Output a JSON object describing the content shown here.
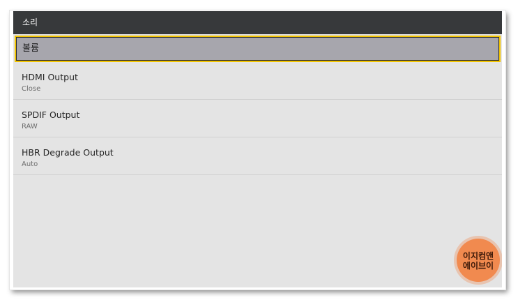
{
  "header": {
    "title": "소리"
  },
  "selected_item": {
    "label": "볼륨"
  },
  "settings": [
    {
      "title": "HDMI Output",
      "value": "Close"
    },
    {
      "title": "SPDIF Output",
      "value": "RAW"
    },
    {
      "title": "HBR Degrade Output",
      "value": "Auto"
    }
  ],
  "watermark": {
    "line1": "이지컴앤",
    "line2": "에이브이"
  },
  "colors": {
    "header": "#37393b",
    "selection": "#a7a6ad",
    "selection_border": "#f2c400",
    "background": "#e4e4e4",
    "watermark": "#f18a4f"
  }
}
